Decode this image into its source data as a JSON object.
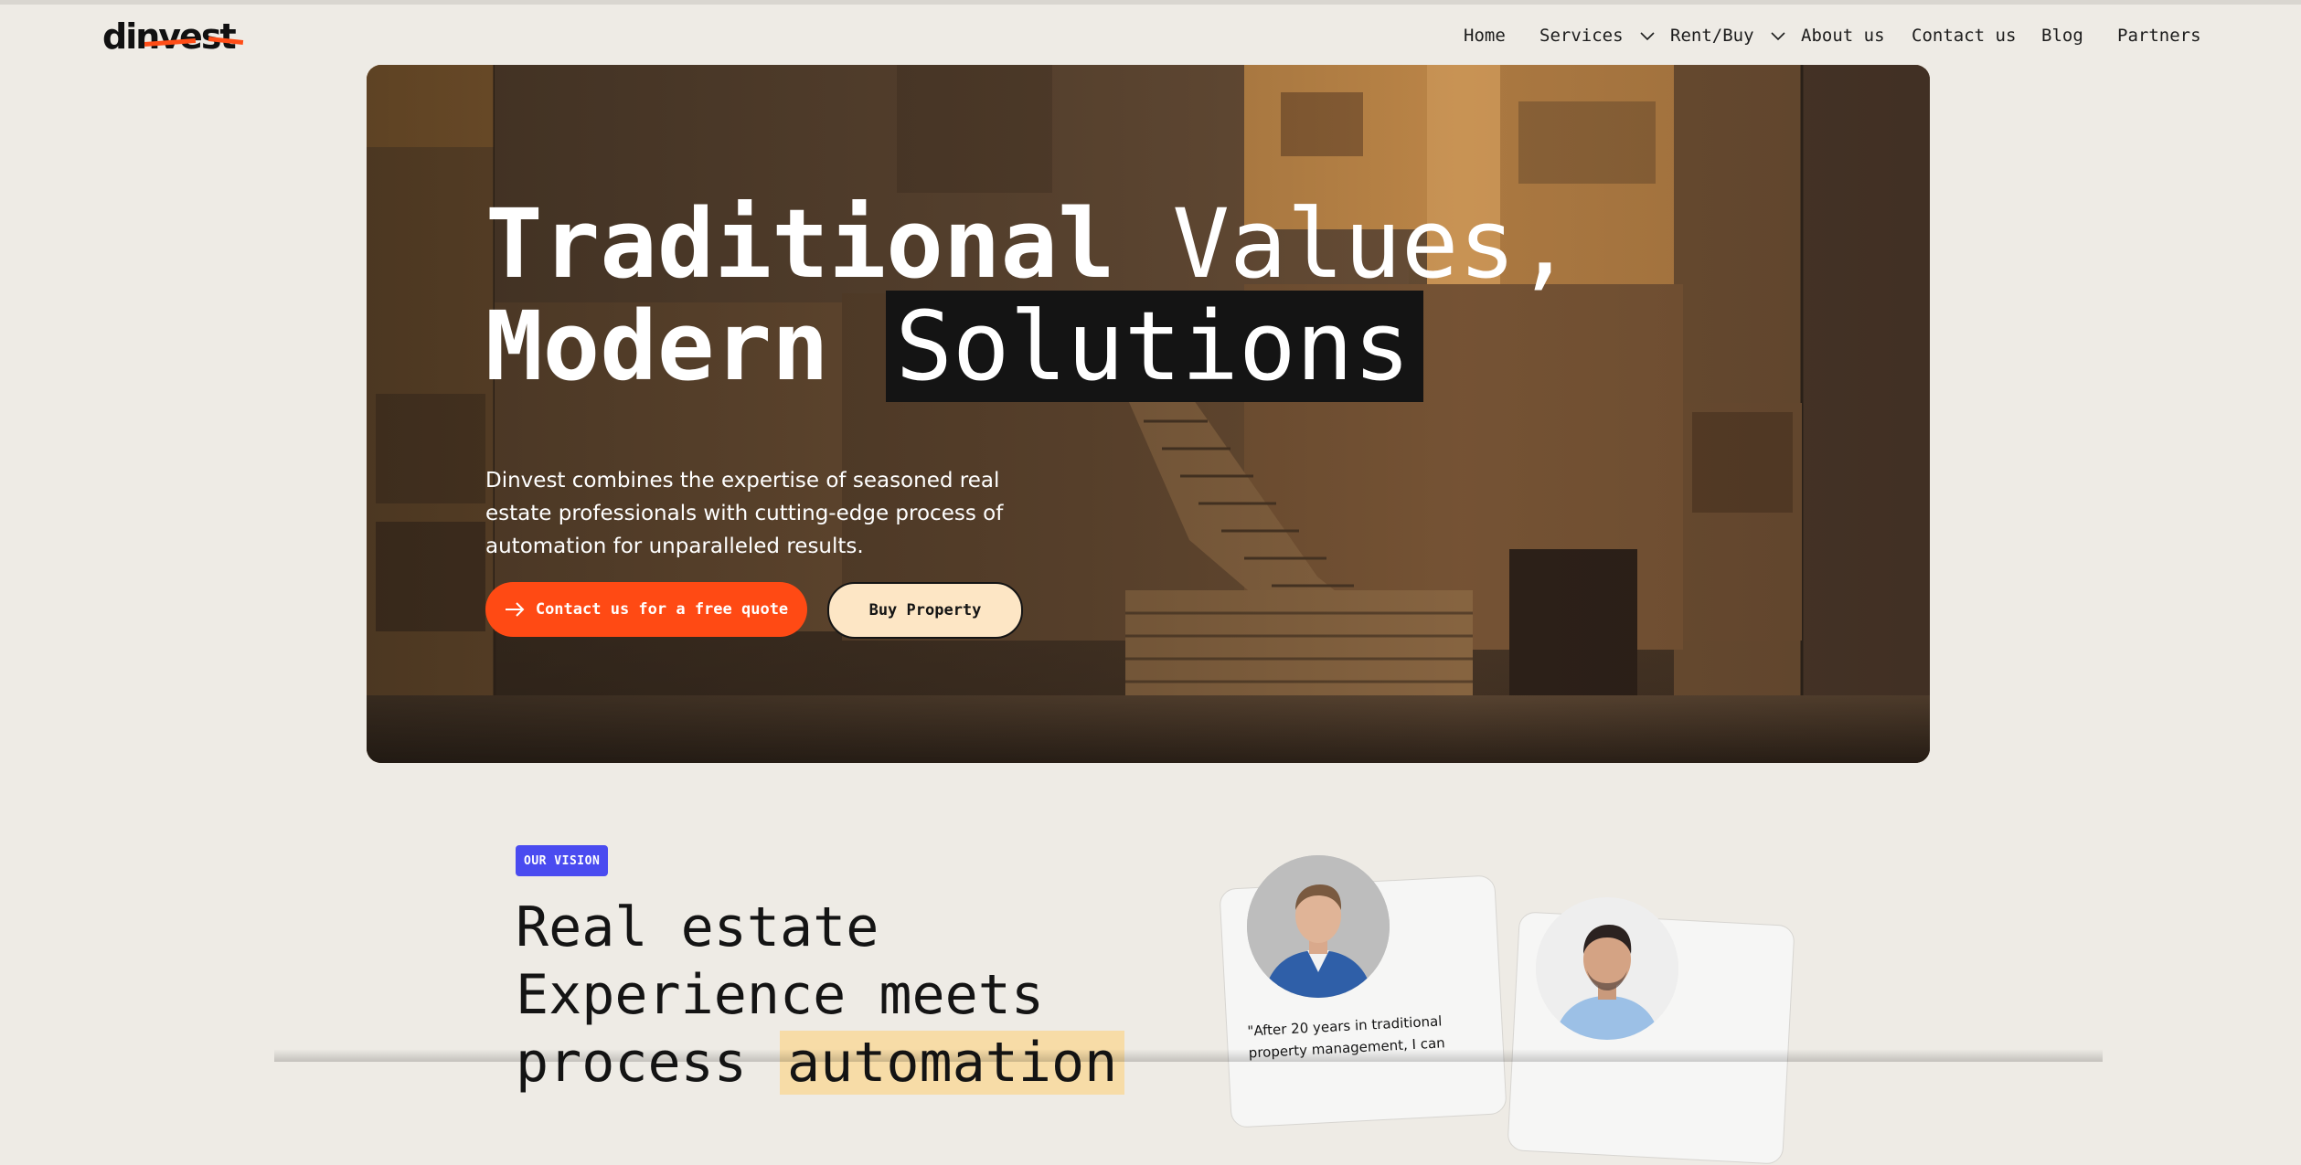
{
  "logo": {
    "text": "dinvest"
  },
  "nav": {
    "items": [
      {
        "label": "Home"
      },
      {
        "label": "Services",
        "has_dropdown": true
      },
      {
        "label": "Rent/Buy",
        "has_dropdown": true
      },
      {
        "label": "About us"
      },
      {
        "label": "Contact us"
      },
      {
        "label": "Blog"
      },
      {
        "label": "Partners"
      }
    ]
  },
  "hero": {
    "title_line1_bold": "Traditional",
    "title_line1_light": "Values,",
    "title_line2_bold": "Modern",
    "title_line2_boxed": "Solutions",
    "description": "Dinvest combines the expertise of seasoned real estate professionals with cutting-edge process of automation for unparalleled results.",
    "primary_button": "Contact us for a free quote",
    "secondary_button": "Buy Property"
  },
  "vision": {
    "badge": "OUR VISION",
    "title_line1": "Real estate",
    "title_line2": "Experience meets",
    "title_line3_plain": "process",
    "title_line3_highlight": "automation"
  },
  "testimonials": {
    "quote_1": "\"After 20 years in traditional property management, I  can"
  },
  "colors": {
    "background": "#eeebe5",
    "accent_orange": "#ff4a14",
    "badge_blue": "#4a4bf0",
    "highlight_yellow": "#f7dca7",
    "secondary_button": "#fde6c5"
  }
}
